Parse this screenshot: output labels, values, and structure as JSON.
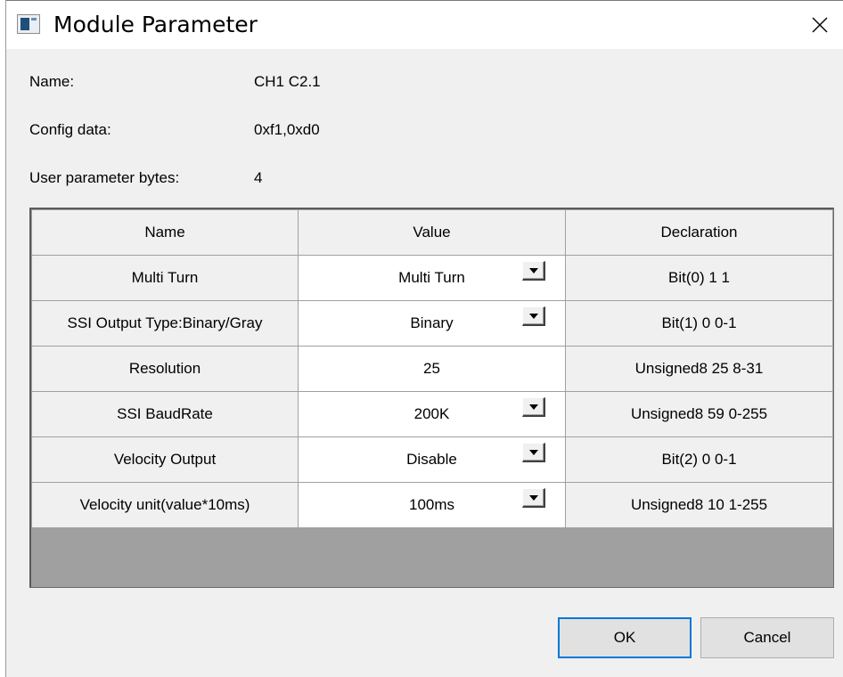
{
  "window": {
    "title": "Module Parameter"
  },
  "info": {
    "name_label": "Name:",
    "name_value": "CH1 C2.1",
    "config_label": "Config data:",
    "config_value": "0xf1,0xd0",
    "bytes_label": "User parameter bytes:",
    "bytes_value": "4"
  },
  "table": {
    "headers": {
      "name": "Name",
      "value": "Value",
      "declaration": "Declaration"
    },
    "rows": [
      {
        "name": "Multi Turn",
        "value": "Multi Turn",
        "declaration": "Bit(0) 1 1",
        "dropdown": true
      },
      {
        "name": "SSI Output Type:Binary/Gray",
        "value": "Binary",
        "declaration": "Bit(1) 0 0-1",
        "dropdown": true
      },
      {
        "name": "Resolution",
        "value": "25",
        "declaration": "Unsigned8 25 8-31",
        "dropdown": false
      },
      {
        "name": "SSI BaudRate",
        "value": "200K",
        "declaration": "Unsigned8 59 0-255",
        "dropdown": true
      },
      {
        "name": "Velocity Output",
        "value": "Disable",
        "declaration": "Bit(2) 0 0-1",
        "dropdown": true
      },
      {
        "name": "Velocity unit(value*10ms)",
        "value": "100ms",
        "declaration": "Unsigned8 10 1-255",
        "dropdown": true
      }
    ]
  },
  "buttons": {
    "ok": "OK",
    "cancel": "Cancel"
  }
}
